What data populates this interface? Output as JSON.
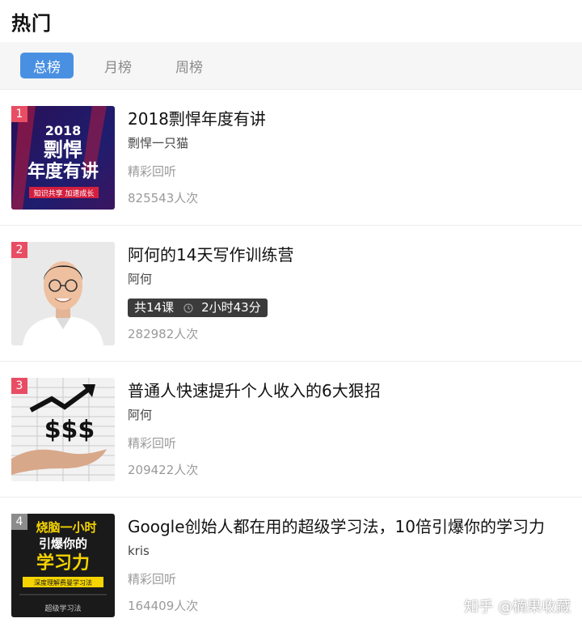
{
  "header": {
    "title": "热门"
  },
  "tabs": [
    {
      "label": "总榜",
      "active": true
    },
    {
      "label": "月榜",
      "active": false
    },
    {
      "label": "周榜",
      "active": false
    }
  ],
  "items": [
    {
      "rank": "1",
      "title": "2018剽悍年度有讲",
      "author": "剽悍一只猫",
      "tag": "精彩回听",
      "count": "825543人次",
      "cover_text": [
        "2018",
        "剽悍",
        "年度有讲",
        "知识共享 加速成长"
      ]
    },
    {
      "rank": "2",
      "title": "阿何的14天写作训练营",
      "author": "阿何",
      "lessons": "共14课",
      "duration": "2小时43分",
      "count": "282982人次"
    },
    {
      "rank": "3",
      "title": "普通人快速提升个人收入的6大狠招",
      "author": "阿何",
      "tag": "精彩回听",
      "count": "209422人次",
      "cover_text": [
        "$$$"
      ]
    },
    {
      "rank": "4",
      "title": "Google创始人都在用的超级学习法，10倍引爆你的学习力",
      "author": "kris",
      "tag": "精彩回听",
      "count": "164409人次",
      "cover_text": [
        "烧脑一小时",
        "引爆你的",
        "学习力",
        "深度理解费曼学习法",
        "超级学习法"
      ]
    }
  ],
  "watermark": "知乎 @楠果收藏",
  "colors": {
    "tab_active": "#4a90e2",
    "rank_top": "#e84d63",
    "rank_other": "#8c8c8c"
  }
}
